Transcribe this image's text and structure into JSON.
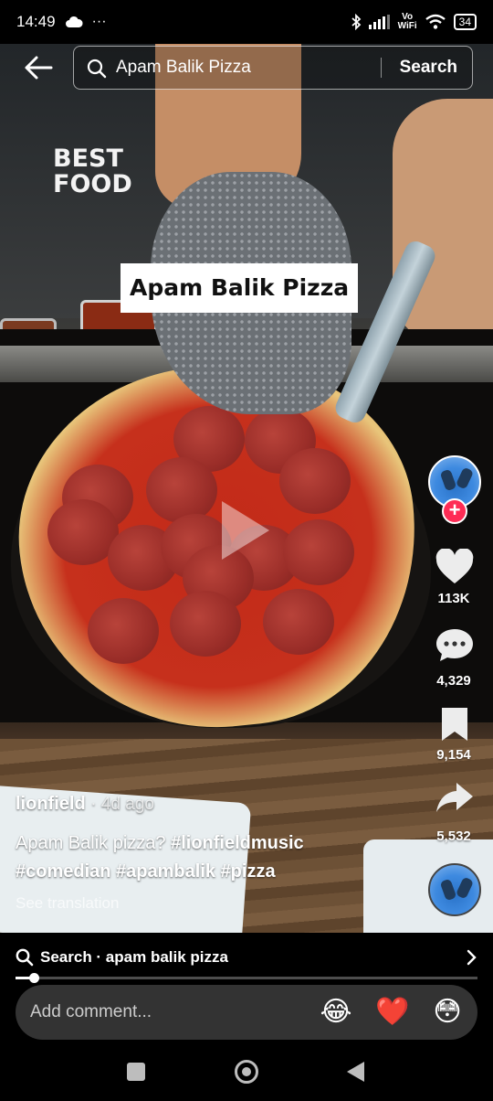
{
  "status_bar": {
    "time": "14:49",
    "more": "···",
    "network": "Vo\nWiFi",
    "battery": "34"
  },
  "search": {
    "query": "Apam Balik Pizza",
    "button_label": "Search"
  },
  "video": {
    "brand_line1": "BEST",
    "brand_line2": "FOOD",
    "overlay_text": "Apam Balik Pizza"
  },
  "actions": {
    "likes": "113K",
    "comments": "4,329",
    "saves": "9,154",
    "shares": "5,532"
  },
  "post": {
    "author": "lionfield",
    "date": "· 4d ago",
    "caption_text": "Apam Balik pizza? ",
    "hashtags": [
      "#lionfieldmusic",
      "#comedian",
      "#apambalik",
      "#pizza"
    ],
    "see_translation": "See translation"
  },
  "related_search": {
    "label": "Search · apam balik pizza"
  },
  "playback": {
    "progress_fraction": 0.035
  },
  "comment": {
    "placeholder": "Add comment..."
  },
  "colors": {
    "follow_accent": "#fe2c55",
    "comment_bg": "#333333"
  },
  "icons": [
    "back-arrow-icon",
    "search-icon",
    "heart-icon",
    "comment-icon",
    "bookmark-icon",
    "share-icon",
    "chevron-right-icon",
    "play-icon"
  ]
}
